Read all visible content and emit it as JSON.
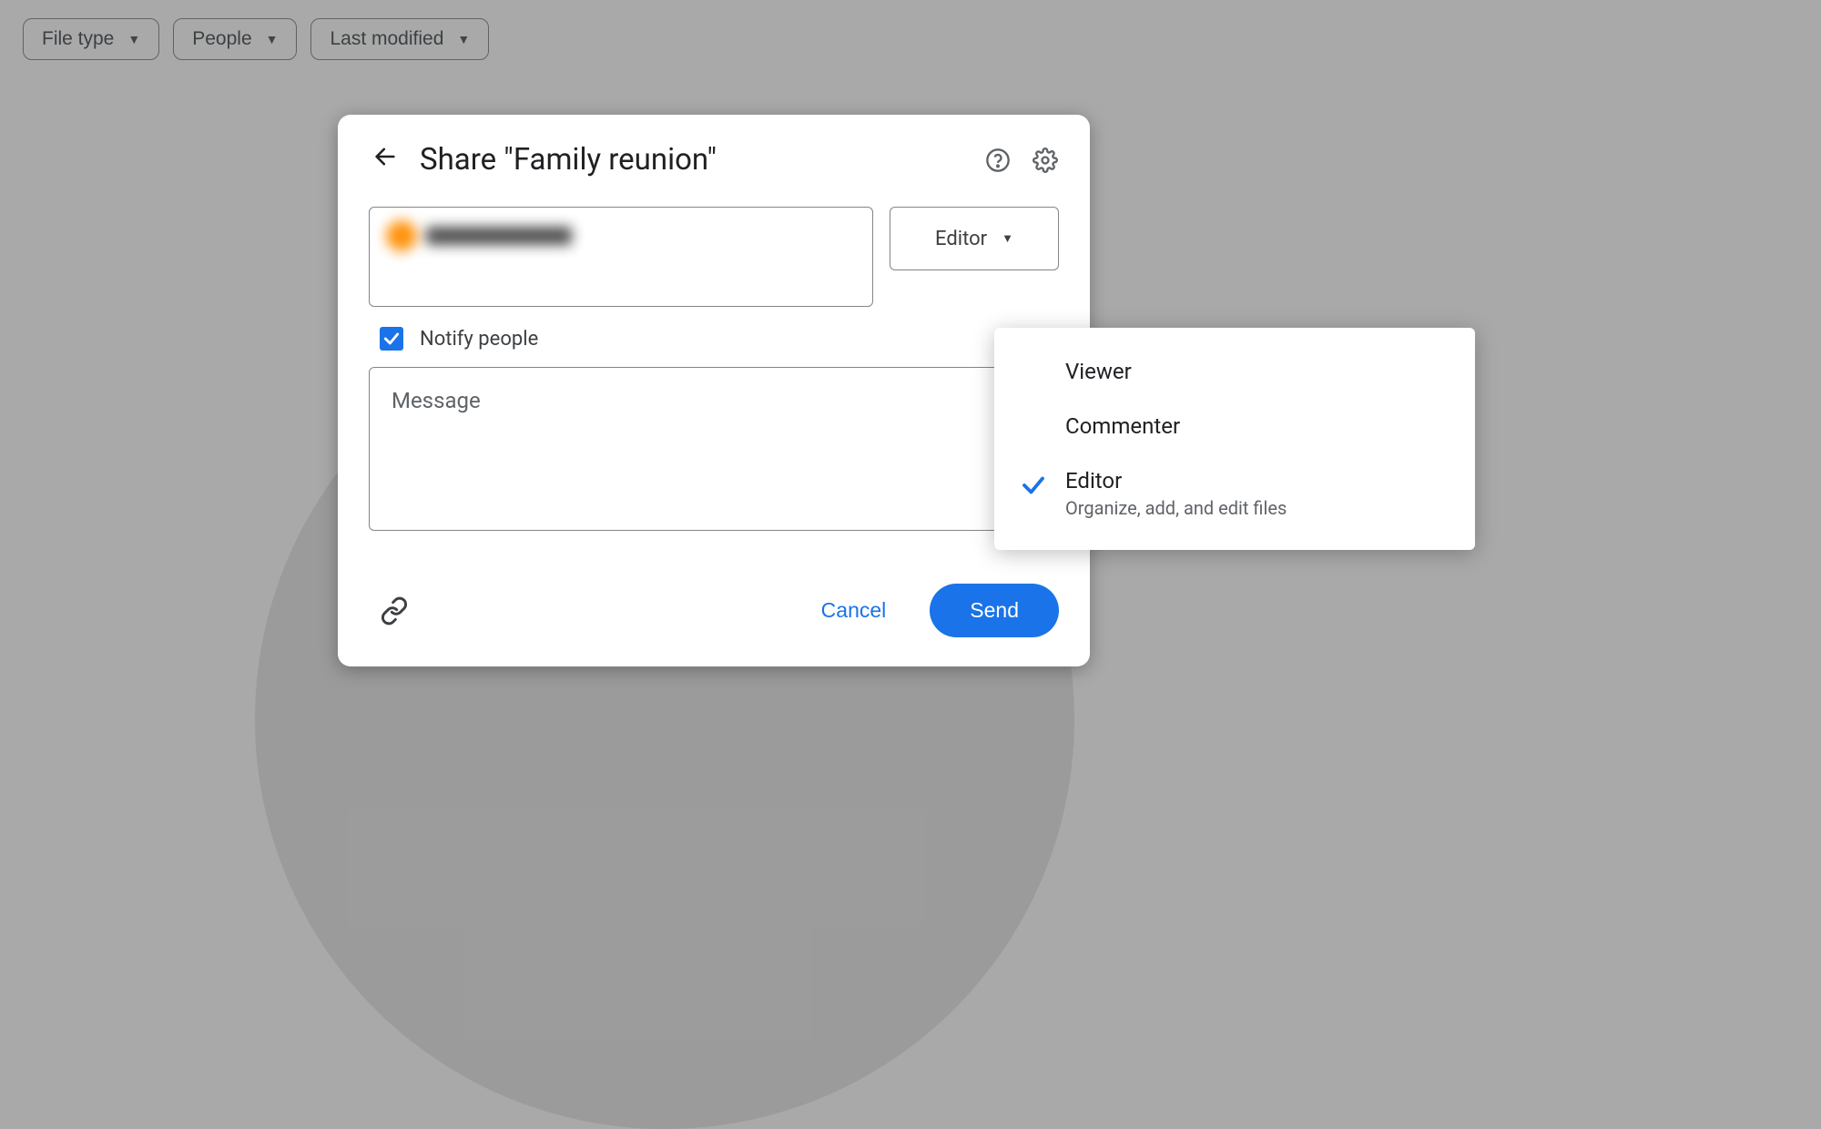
{
  "filters": {
    "file_type": "File type",
    "people": "People",
    "last_modified": "Last modified"
  },
  "dialog": {
    "title": "Share \"Family reunion\"",
    "role_selected": "Editor",
    "notify_label": "Notify people",
    "notify_checked": true,
    "message_placeholder": "Message",
    "cancel_label": "Cancel",
    "send_label": "Send"
  },
  "role_menu": {
    "options": [
      {
        "label": "Viewer",
        "desc": "",
        "selected": false
      },
      {
        "label": "Commenter",
        "desc": "",
        "selected": false
      },
      {
        "label": "Editor",
        "desc": "Organize, add, and edit files",
        "selected": true
      }
    ]
  },
  "colors": {
    "primary": "#1a73e8",
    "text": "#202124",
    "muted": "#5f6368"
  }
}
